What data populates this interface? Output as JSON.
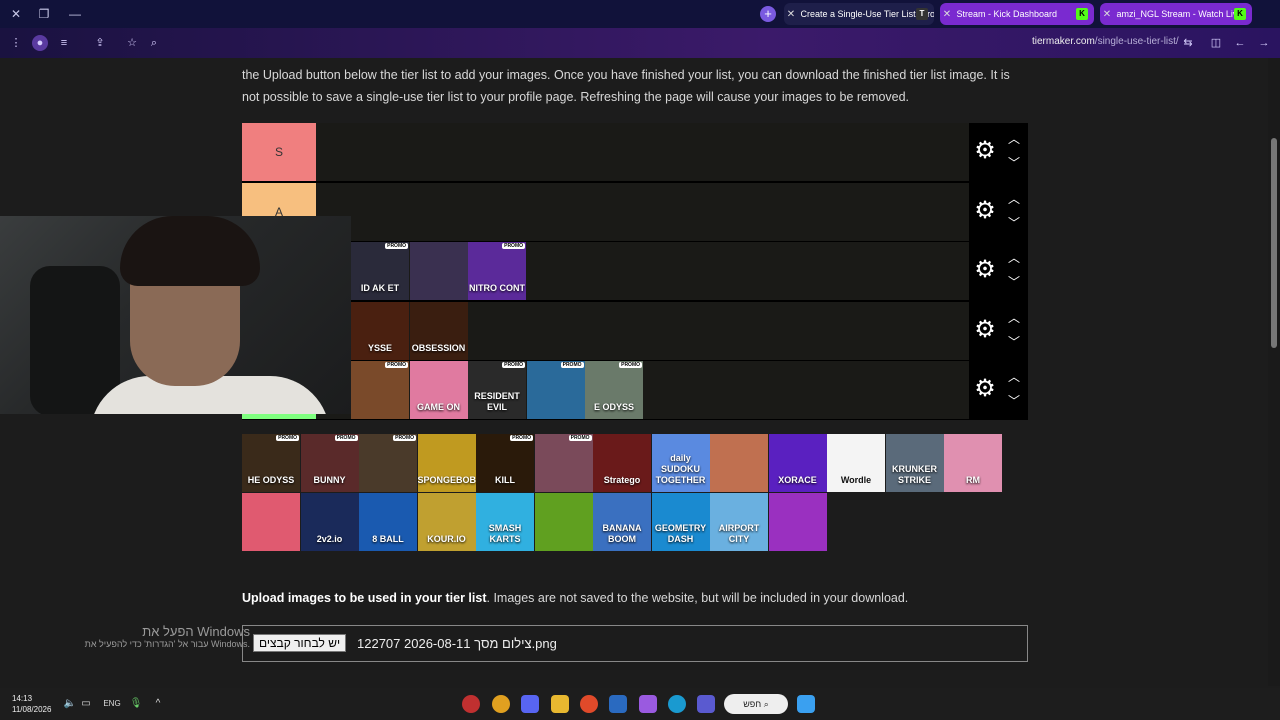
{
  "browser": {
    "tabs": [
      {
        "label": "Create a Single-Use Tier List (Prompt)",
        "active": true,
        "favicon": "T"
      },
      {
        "label": "Stream - Kick Dashboard",
        "active": false,
        "favicon": "K"
      },
      {
        "label": "amzi_NGL Stream - Watch Live",
        "active": false,
        "favicon": "K"
      }
    ],
    "url_domain": "tiermaker.com",
    "url_path": "/single-use-tier-list/"
  },
  "page": {
    "intro_lines": [
      "the Upload button below the tier list to add your images. Once you have finished your list, you can download the finished tier list image. It is",
      "not possible to save a single-use tier list to your profile page. Refreshing the page will cause your images to be removed."
    ],
    "tiers": [
      {
        "label": "S",
        "color": "#f07f7f",
        "items": []
      },
      {
        "label": "A",
        "color": "#f7bf7f",
        "items": []
      },
      {
        "label": "",
        "color": "#f7df7f",
        "items": [
          {
            "caption": "ID AK ET",
            "color": "#2a2a3a",
            "promo": true
          },
          {
            "caption": "",
            "color": "#3a3050",
            "promo": false
          },
          {
            "caption": "NITRO CONT",
            "color": "#5b2a9a",
            "promo": true
          }
        ]
      },
      {
        "label": "",
        "color": "#dfff7f",
        "items": [
          {
            "caption": "YSSE",
            "color": "#4a2010",
            "promo": false
          },
          {
            "caption": "OBSESSION",
            "color": "#3a1e10",
            "promo": false
          }
        ]
      },
      {
        "label": "",
        "color": "#7fff7f",
        "items": [
          {
            "caption": "",
            "color": "#7a4a2a",
            "promo": true
          },
          {
            "caption": "GAME ON",
            "color": "#e07aa0",
            "promo": false
          },
          {
            "caption": "RESIDENT EVIL",
            "color": "#2a2a2a",
            "promo": true
          },
          {
            "caption": "",
            "color": "#2a6a9a",
            "promo": true
          },
          {
            "caption": "E ODYSS",
            "color": "#6a7a6a",
            "promo": true
          }
        ]
      }
    ],
    "tier_controls": {
      "settings_icon": "gear-icon",
      "up_icon": "chevron-up-icon",
      "down_icon": "chevron-down-icon"
    },
    "pool_items": [
      {
        "caption": "HE ODYSS",
        "color": "#3a2a1a",
        "promo": true
      },
      {
        "caption": "BUNNY",
        "color": "#5a2a2a",
        "promo": true
      },
      {
        "caption": "",
        "color": "#4a3a2a",
        "promo": true
      },
      {
        "caption": "SPONGEBOB",
        "color": "#c09a20",
        "promo": false
      },
      {
        "caption": "KILL",
        "color": "#2a1a0a",
        "promo": true
      },
      {
        "caption": "",
        "color": "#7a4a5a",
        "promo": true
      },
      {
        "caption": "Stratego",
        "color": "#6a1a1a",
        "promo": false
      },
      {
        "caption": "daily SUDOKU TOGETHER",
        "color": "#5a8ae0",
        "promo": false
      },
      {
        "caption": "",
        "color": "#c07050",
        "promo": false
      },
      {
        "caption": "XORACE",
        "color": "#5a20c0",
        "promo": false
      },
      {
        "caption": "Wordle",
        "color": "#f4f4f4",
        "promo": false
      },
      {
        "caption": "KRUNKER STRIKE",
        "color": "#5a6a7a",
        "promo": false
      },
      {
        "caption": "RM",
        "color": "#e090b0",
        "promo": false
      },
      {
        "caption": "",
        "color": "#e05a70",
        "promo": false
      },
      {
        "caption": "2v2.io",
        "color": "#1a2a5a",
        "promo": false
      },
      {
        "caption": "8 BALL",
        "color": "#1a5ab0",
        "promo": false
      },
      {
        "caption": "KOUR.IO",
        "color": "#c0a030",
        "promo": false
      },
      {
        "caption": "SMASH KARTS",
        "color": "#30b0e0",
        "promo": false
      },
      {
        "caption": "",
        "color": "#60a020",
        "promo": false
      },
      {
        "caption": "BANANA BOOM",
        "color": "#3a70c0",
        "promo": false
      },
      {
        "caption": "GEOMETRY DASH",
        "color": "#1a8ad0",
        "promo": false
      },
      {
        "caption": "AIRPORT CITY",
        "color": "#6ab0e0",
        "promo": false
      },
      {
        "caption": "",
        "color": "#9a30c0",
        "promo": false
      }
    ],
    "upload_bold": "Upload images to be used in your tier list",
    "upload_rest": ". Images are not saved to the website, but will be included in your download.",
    "file_button": "יש לבחור קבצים",
    "file_name": "צילום מסך 2026-08-11 122707.png",
    "watermark_line1": "הפעל את Windows",
    "watermark_line2": "עבור אל 'הגדרות' כדי להפעיל את Windows."
  },
  "taskbar": {
    "time": "14:13",
    "date": "11/08/2026",
    "lang": "ENG",
    "search_label": "חפש"
  }
}
